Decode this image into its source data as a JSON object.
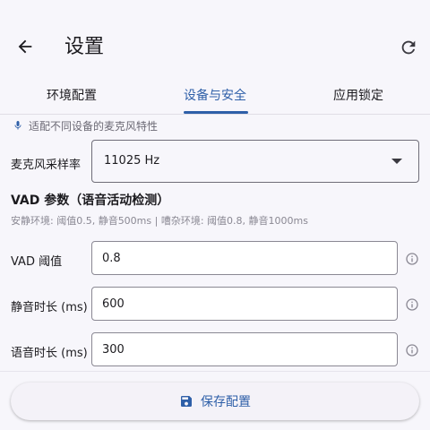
{
  "app": {
    "title": "设置"
  },
  "tabs": [
    {
      "label": "环境配置"
    },
    {
      "label": "设备与安全",
      "active": true
    },
    {
      "label": "应用锁定"
    }
  ],
  "hint": {
    "text": "适配不同设备的麦克风特性",
    "icon": "mic-icon"
  },
  "mic_sample_rate": {
    "label": "麦克风采样率",
    "value": "11025 Hz"
  },
  "vad": {
    "title": "VAD 参数（语音活动检测）",
    "subtitle": "安静环境: 阈值0.5, 静音500ms | 嘈杂环境: 阈值0.8, 静音1000ms",
    "fields": [
      {
        "label": "VAD 阈值",
        "value": "0.8"
      },
      {
        "label": "静音时长 (ms)",
        "value": "600"
      },
      {
        "label": "语音时长 (ms)",
        "value": "300"
      }
    ]
  },
  "save_button": {
    "label": "保存配置"
  },
  "colors": {
    "accent": "#2e5fa8",
    "background": "#f7f6fb"
  }
}
